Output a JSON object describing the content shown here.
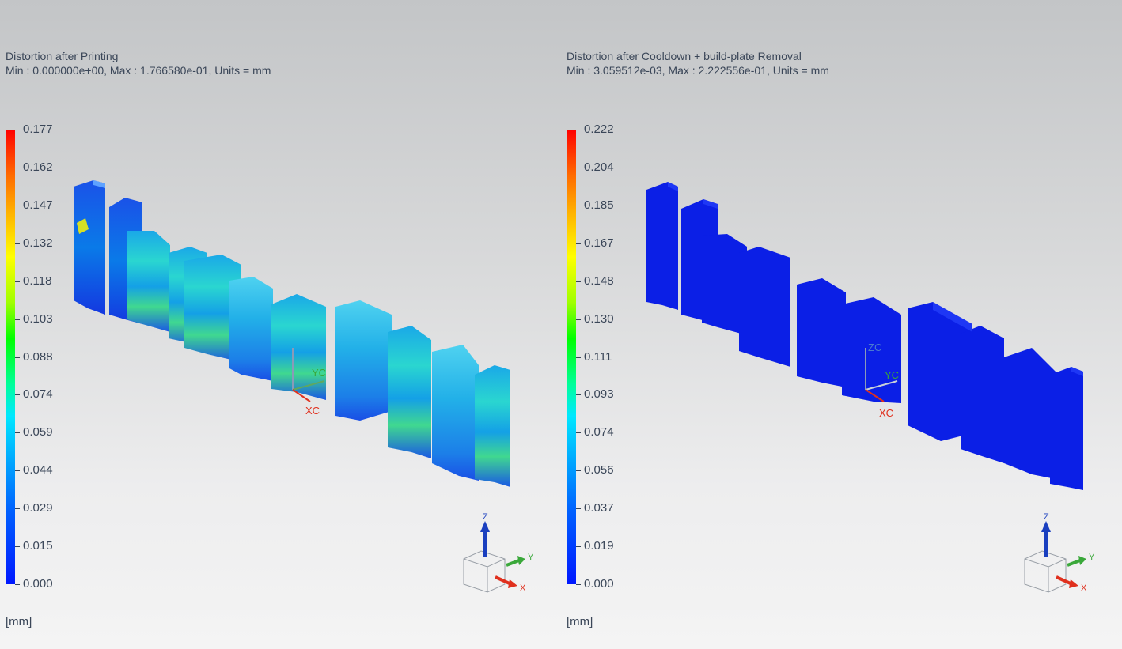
{
  "left": {
    "title": "Distortion after Printing",
    "subtitle": "Min : 0.000000e+00, Max : 1.766580e-01, Units = mm",
    "legend_ticks": [
      "0.177",
      "0.162",
      "0.147",
      "0.132",
      "0.118",
      "0.103",
      "0.088",
      "0.074",
      "0.059",
      "0.044",
      "0.029",
      "0.015",
      "0.000"
    ],
    "unit": "[mm]"
  },
  "right": {
    "title": "Distortion after Cooldown + build-plate Removal",
    "subtitle": "Min : 3.059512e-03, Max : 2.222556e-01, Units = mm",
    "legend_ticks": [
      "0.222",
      "0.204",
      "0.185",
      "0.167",
      "0.148",
      "0.130",
      "0.111",
      "0.093",
      "0.074",
      "0.056",
      "0.037",
      "0.019",
      "0.000"
    ],
    "unit": "[mm]"
  },
  "axes": {
    "xc": "XC",
    "yc": "YC",
    "zc": "ZC",
    "x": "X",
    "y": "Y",
    "z": "Z"
  },
  "colors": {
    "x_axis": "#e0301e",
    "y_axis": "#3aa83a",
    "z_axis": "#1a3fbf",
    "model_right": "#0b1fe6"
  }
}
